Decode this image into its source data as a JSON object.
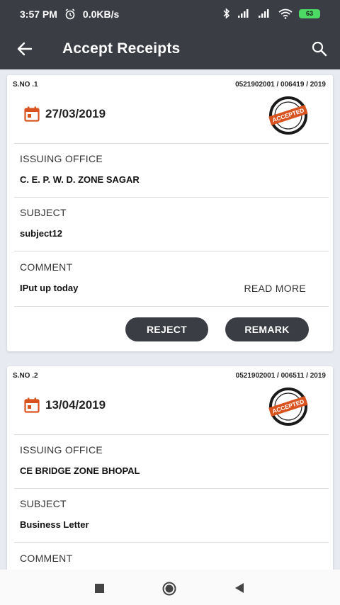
{
  "status": {
    "time": "3:57 PM",
    "speed": "0.0KB/s",
    "battery": "63"
  },
  "appbar": {
    "title": "Accept Receipts"
  },
  "stamp_text": "ACCEPTED",
  "labels": {
    "issuing_office": "ISSUING OFFICE",
    "subject": "SUBJECT",
    "comment": "COMMENT",
    "read_more": "READ MORE",
    "reject": "REJECT",
    "remark": "REMARK"
  },
  "receipts": [
    {
      "sno": "S.NO .1",
      "ref": "0521902001 / 006419 / 2019",
      "date": "27/03/2019",
      "issuing_office": "C. E.   P. W. D. ZONE SAGAR",
      "subject": "subject12",
      "comment": "IPut up today"
    },
    {
      "sno": "S.NO .2",
      "ref": "0521902001 / 006511 / 2019",
      "date": "13/04/2019",
      "issuing_office": "CE BRIDGE ZONE BHOPAL",
      "subject": "Business Letter"
    }
  ],
  "colors": {
    "appbar": "#3a3d44",
    "accent": "#d9531e",
    "button": "#3a3d44"
  }
}
